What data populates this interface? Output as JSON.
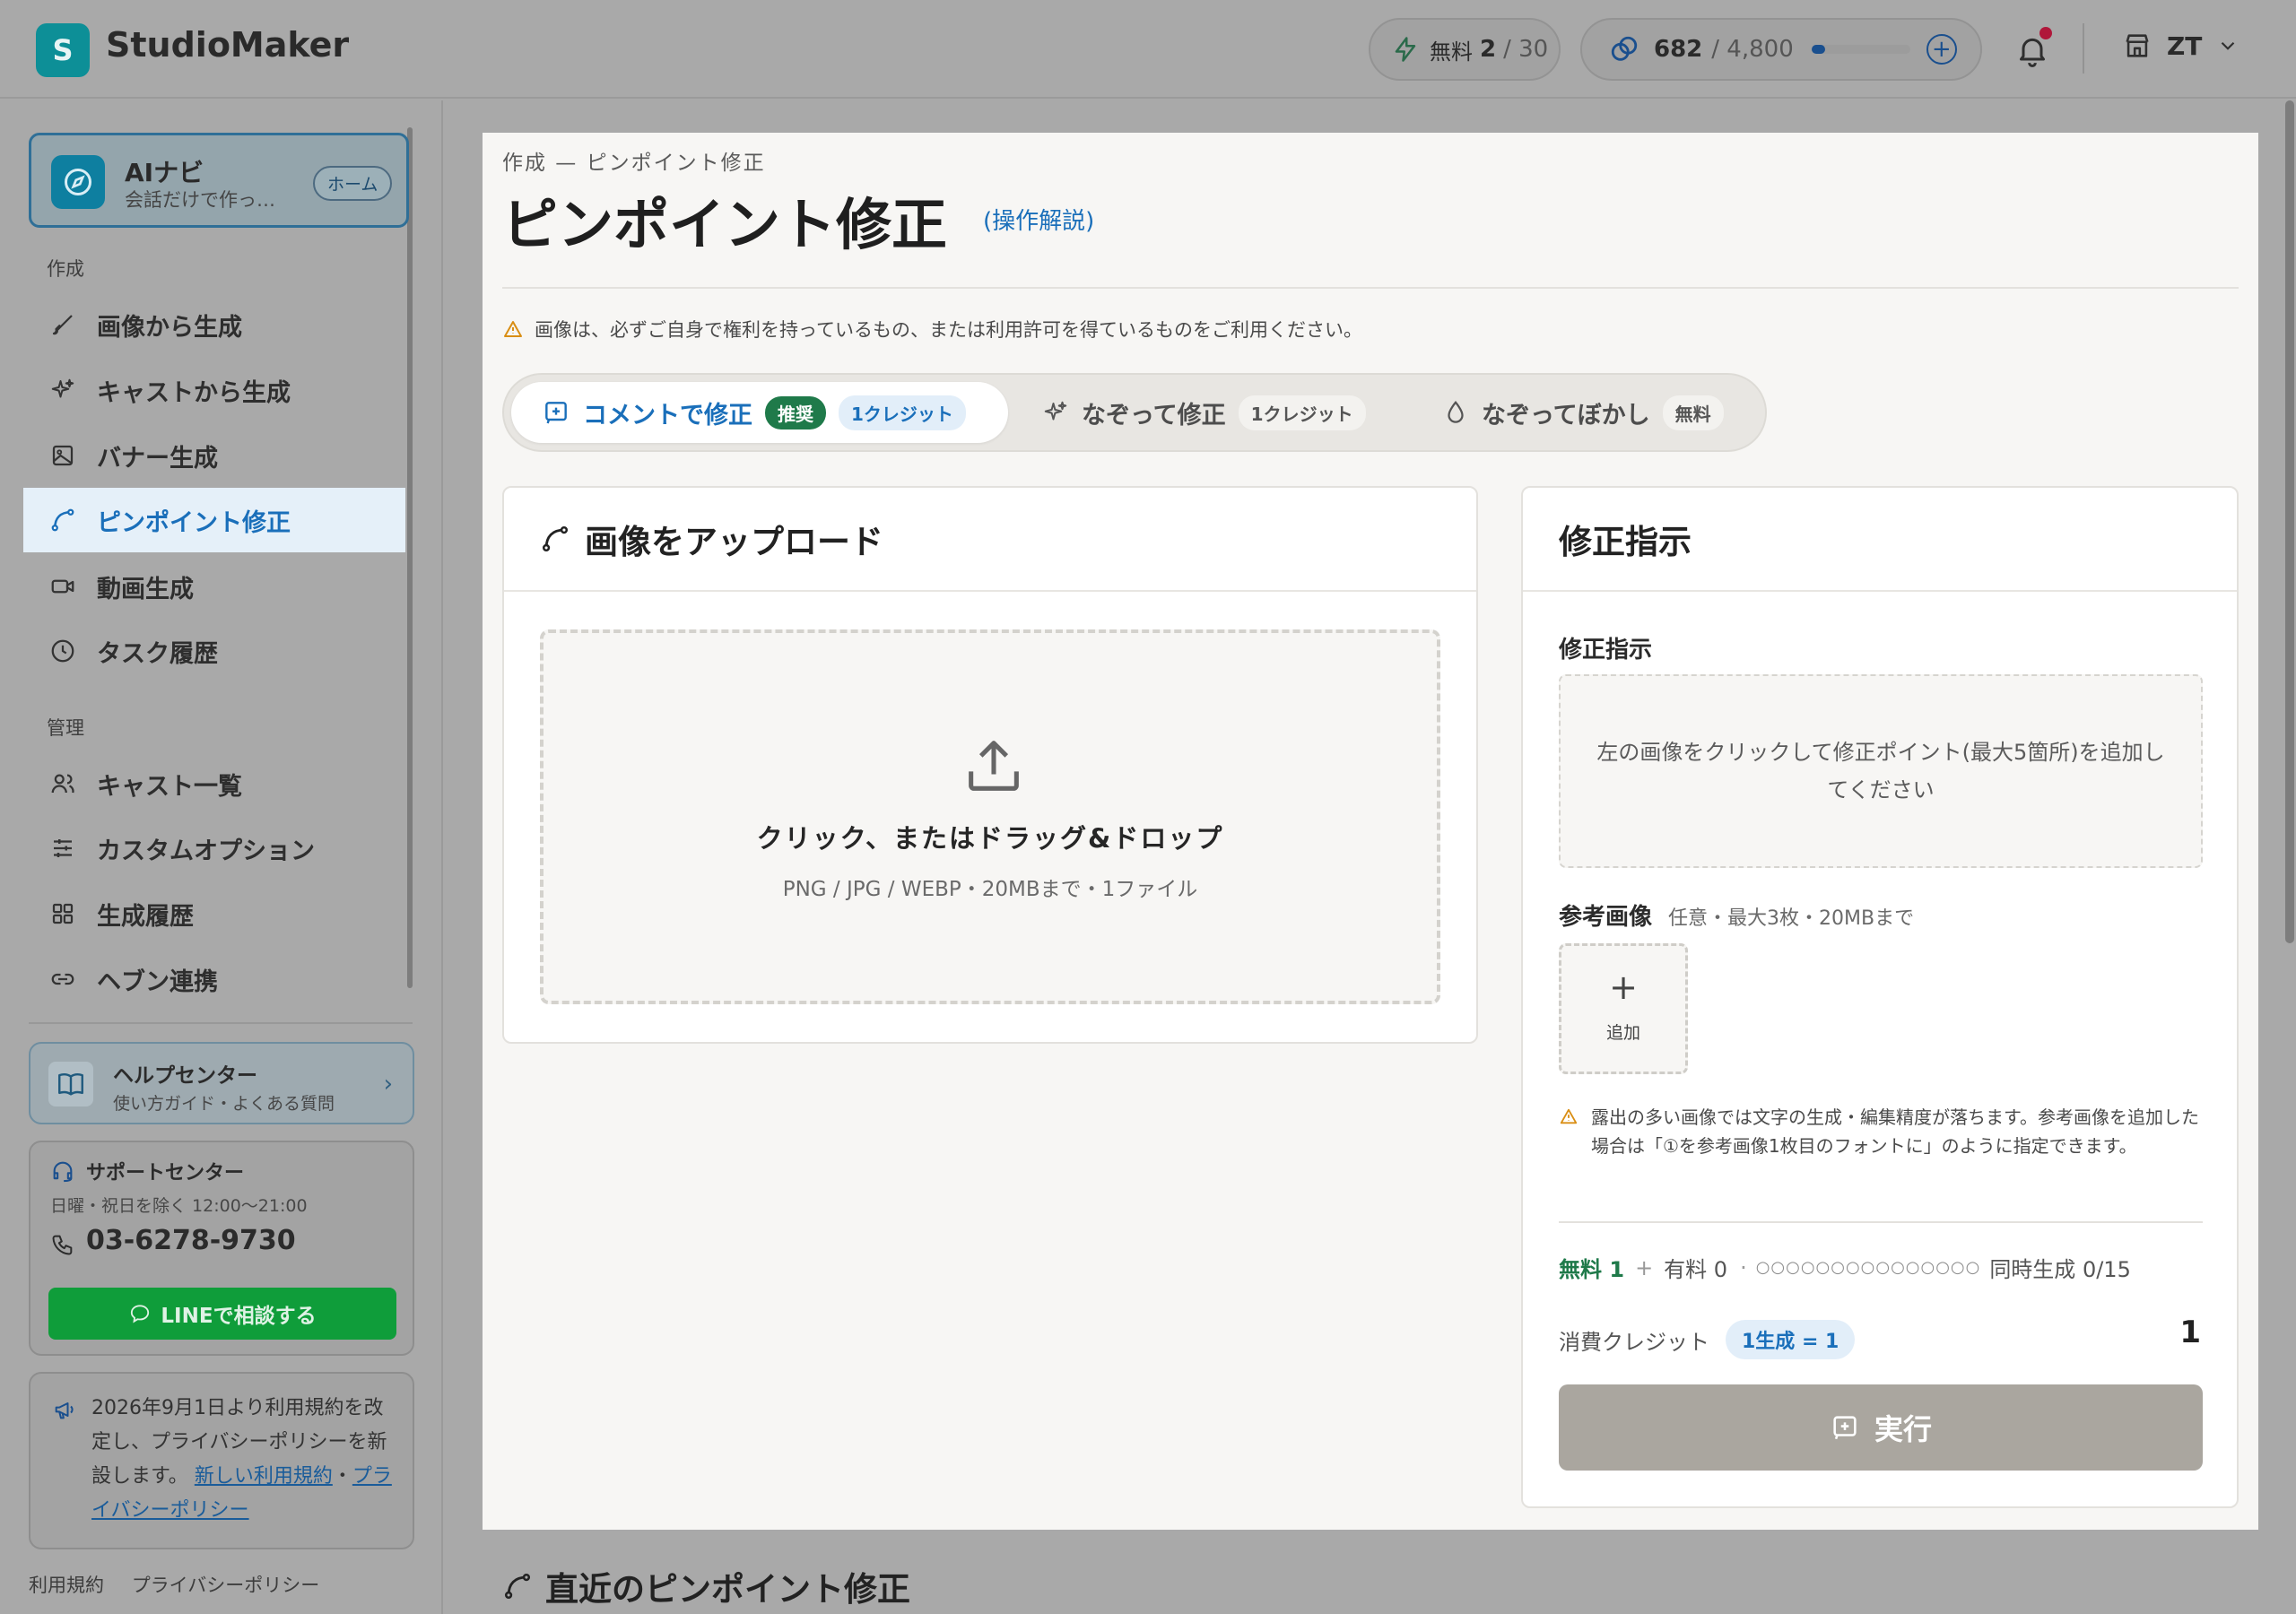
{
  "app": {
    "name": "StudioMaker",
    "logo_letter": "S"
  },
  "header": {
    "free_label": "無料",
    "free_used": "2",
    "free_total": "/ 30",
    "credits_value": "682",
    "credits_total": "/ 4,800",
    "credits_fraction": 0.142,
    "add_credit": "+",
    "user_initials": "ZT"
  },
  "sidebar": {
    "ainavi": {
      "title": "AIナビ",
      "subtitle": "会話だけで作っ…",
      "badge": "ホーム"
    },
    "section_create": "作成",
    "create_items": [
      {
        "label": "画像から生成",
        "icon": "brush-icon"
      },
      {
        "label": "キャストから生成",
        "icon": "sparkle-icon"
      },
      {
        "label": "バナー生成",
        "icon": "image-icon"
      },
      {
        "label": "ピンポイント修正",
        "icon": "pen-curve-icon",
        "active": true
      },
      {
        "label": "動画生成",
        "icon": "video-icon"
      },
      {
        "label": "タスク履歴",
        "icon": "clock-icon"
      }
    ],
    "section_manage": "管理",
    "manage_items": [
      {
        "label": "キャスト一覧",
        "icon": "users-icon"
      },
      {
        "label": "カスタムオプション",
        "icon": "sliders-icon"
      },
      {
        "label": "生成履歴",
        "icon": "grid-icon"
      },
      {
        "label": "ヘブン連携",
        "icon": "link-icon"
      }
    ],
    "help": {
      "title": "ヘルプセンター",
      "subtitle": "使い方ガイド・よくある質問"
    },
    "support": {
      "title": "サポートセンター",
      "hours": "日曜・祝日を除く 12:00〜21:00",
      "phone": "03-6278-9730",
      "line_button": "LINEで相談する"
    },
    "notice": {
      "text": "2026年9月1日より利用規約を改定し、プライバシーポリシーを新設します。",
      "link1": "新しい利用規約",
      "sep": "・",
      "link2": "プライバシーポリシー"
    },
    "footer": {
      "terms": "利用規約",
      "privacy": "プライバシーポリシー"
    }
  },
  "page": {
    "breadcrumb": "作成 — ピンポイント修正",
    "title": "ピンポイント修正",
    "howto": "(操作解説)",
    "warning": "画像は、必ずご自身で権利を持っているもの、または利用許可を得ているものをご利用ください。",
    "tabs": [
      {
        "label": "コメントで修正",
        "badge": "推奨",
        "price": "1クレジット"
      },
      {
        "label": "なぞって修正",
        "price": "1クレジット"
      },
      {
        "label": "なぞってぼかし",
        "price": "無料"
      }
    ],
    "upload": {
      "title": "画像をアップロード",
      "drop_text": "クリック、またはドラッグ&ドロップ",
      "formats": "PNG / JPG / WEBP・20MBまで・1ファイル"
    },
    "fix": {
      "panel_title": "修正指示",
      "field_label": "修正指示",
      "placeholder": "左の画像をクリックして修正ポイント(最大5箇所)を追加してください",
      "ref_label": "参考画像",
      "ref_hint": "任意・最大3枚・20MBまで",
      "add": "追加",
      "caution": "露出の多い画像では文字の生成・編集精度が落ちます。参考画像を追加した場合は「①を参考画像1枚目のフォントに」のように指定できます。",
      "free_count": "無料 1",
      "plus": "+",
      "paid_count": "有料 0",
      "dot_sep": "·",
      "dots": "○○○○○○○○○○○○○○○",
      "concurrent": "同時生成 0/15",
      "cost_label": "消費クレジット",
      "cost_badge": "1生成 = 1",
      "cost_value": "1",
      "run": "実行"
    },
    "recent_title": "直近のピンポイント修正"
  },
  "colors": {
    "accent": "#1a6fba",
    "brand": "#0d8f97",
    "green": "#1f7a4a",
    "line": "#0f9d3a"
  }
}
